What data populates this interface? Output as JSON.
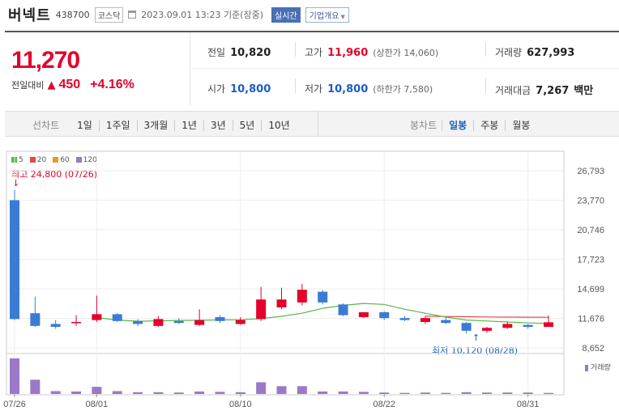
{
  "header": {
    "stock_name": "버넥트",
    "stock_code": "438700",
    "market": "코스닥",
    "datetime": "2023.09.01 13:23 기준(장중)",
    "realtime_label": "실시간",
    "company_info_label": "기업개요"
  },
  "price": {
    "current": "11,270",
    "change_label": "전일대비",
    "change_direction": "up",
    "change_value": "450",
    "change_percent": "+4.16%"
  },
  "stats": {
    "prev_close": {
      "label": "전일",
      "value": "10,820"
    },
    "open": {
      "label": "시가",
      "value": "10,800"
    },
    "high": {
      "label": "고가",
      "value": "11,960",
      "limit_label": "(상한가 14,060)"
    },
    "low": {
      "label": "저가",
      "value": "10,800",
      "limit_label": "(하한가 7,580)"
    },
    "volume": {
      "label": "거래량",
      "value": "627,993"
    },
    "trade_amount": {
      "label": "거래대금",
      "value": "7,267",
      "unit": "백만"
    }
  },
  "period_bar": {
    "line_chart_label": "선차트",
    "line_periods": [
      "1일",
      "1주일",
      "3개월",
      "1년",
      "3년",
      "5년",
      "10년"
    ],
    "candle_chart_label": "봉차트",
    "candle_periods": [
      "일봉",
      "주봉",
      "월봉"
    ],
    "active_candle_period": "일봉"
  },
  "colors": {
    "up": "#e4002b",
    "down": "#1a5fc0",
    "ma5": "#56b848",
    "ma20": "#e24a4a",
    "ma60": "#f0932b",
    "ma120": "#9b79c6"
  },
  "chart_data": {
    "type": "candlestick",
    "legend": [
      {
        "name": "5",
        "color": "#56b848"
      },
      {
        "name": "20",
        "color": "#e24a4a"
      },
      {
        "name": "60",
        "color": "#f0932b"
      },
      {
        "name": "120",
        "color": "#9b79c6"
      }
    ],
    "y_ticks": [
      "26,793",
      "23,770",
      "20,746",
      "17,723",
      "14,699",
      "11,676",
      "8,652"
    ],
    "ylim": [
      8652,
      26793
    ],
    "x_ticks": [
      {
        "label": "07/26",
        "date": "2023-07-26"
      },
      {
        "label": "08/01",
        "date": "2023-08-01"
      },
      {
        "label": "08/10",
        "date": "2023-08-10"
      },
      {
        "label": "08/22",
        "date": "2023-08-22"
      },
      {
        "label": "08/31",
        "date": "2023-08-31"
      }
    ],
    "high_annotation": "최고 24,800 (07/26)",
    "low_annotation": "최저 10,120 (08/28)",
    "volume_label": "거래량",
    "candles": [
      {
        "date": "2023-07-26",
        "o": 23770,
        "h": 24800,
        "l": 11500,
        "c": 11600,
        "v": 1.0
      },
      {
        "date": "2023-07-27",
        "o": 12200,
        "h": 13900,
        "l": 10800,
        "c": 10900,
        "v": 0.4
      },
      {
        "date": "2023-07-28",
        "o": 11100,
        "h": 11500,
        "l": 10600,
        "c": 10800,
        "v": 0.08
      },
      {
        "date": "2023-07-31",
        "o": 11200,
        "h": 12000,
        "l": 10900,
        "c": 11300,
        "v": 0.07
      },
      {
        "date": "2023-08-01",
        "o": 11500,
        "h": 14000,
        "l": 11300,
        "c": 12100,
        "v": 0.2
      },
      {
        "date": "2023-08-02",
        "o": 12100,
        "h": 12200,
        "l": 11300,
        "c": 11400,
        "v": 0.08
      },
      {
        "date": "2023-08-03",
        "o": 11400,
        "h": 11600,
        "l": 10900,
        "c": 11100,
        "v": 0.05
      },
      {
        "date": "2023-08-04",
        "o": 10900,
        "h": 11900,
        "l": 10800,
        "c": 11600,
        "v": 0.05
      },
      {
        "date": "2023-08-07",
        "o": 11400,
        "h": 11700,
        "l": 11100,
        "c": 11200,
        "v": 0.04
      },
      {
        "date": "2023-08-08",
        "o": 11000,
        "h": 12600,
        "l": 10900,
        "c": 11500,
        "v": 0.07
      },
      {
        "date": "2023-08-09",
        "o": 11800,
        "h": 12000,
        "l": 11200,
        "c": 11400,
        "v": 0.06
      },
      {
        "date": "2023-08-10",
        "o": 11100,
        "h": 11800,
        "l": 11000,
        "c": 11500,
        "v": 0.05
      },
      {
        "date": "2023-08-11",
        "o": 11600,
        "h": 14900,
        "l": 11400,
        "c": 13600,
        "v": 0.33
      },
      {
        "date": "2023-08-14",
        "o": 12800,
        "h": 14800,
        "l": 12600,
        "c": 13600,
        "v": 0.22
      },
      {
        "date": "2023-08-16",
        "o": 13300,
        "h": 15200,
        "l": 13000,
        "c": 14600,
        "v": 0.22
      },
      {
        "date": "2023-08-17",
        "o": 14400,
        "h": 14600,
        "l": 13100,
        "c": 13300,
        "v": 0.07
      },
      {
        "date": "2023-08-18",
        "o": 13100,
        "h": 13200,
        "l": 11900,
        "c": 12000,
        "v": 0.07
      },
      {
        "date": "2023-08-21",
        "o": 11800,
        "h": 12300,
        "l": 11700,
        "c": 12300,
        "v": 0.06
      },
      {
        "date": "2023-08-22",
        "o": 12300,
        "h": 12400,
        "l": 11500,
        "c": 11700,
        "v": 0.04
      },
      {
        "date": "2023-08-23",
        "o": 11700,
        "h": 11900,
        "l": 11400,
        "c": 11500,
        "v": 0.03
      },
      {
        "date": "2023-08-24",
        "o": 11300,
        "h": 11900,
        "l": 11100,
        "c": 11700,
        "v": 0.04
      },
      {
        "date": "2023-08-25",
        "o": 11500,
        "h": 11800,
        "l": 11100,
        "c": 11200,
        "v": 0.03
      },
      {
        "date": "2023-08-28",
        "o": 11200,
        "h": 11300,
        "l": 10120,
        "c": 10400,
        "v": 0.05
      },
      {
        "date": "2023-08-29",
        "o": 10400,
        "h": 10800,
        "l": 10200,
        "c": 10700,
        "v": 0.04
      },
      {
        "date": "2023-08-30",
        "o": 10700,
        "h": 11300,
        "l": 10600,
        "c": 11100,
        "v": 0.04
      },
      {
        "date": "2023-08-31",
        "o": 11000,
        "h": 11100,
        "l": 10600,
        "c": 10800,
        "v": 0.04
      },
      {
        "date": "2023-09-01",
        "o": 10800,
        "h": 11960,
        "l": 10800,
        "c": 11270,
        "v": 0.03
      }
    ],
    "ma5": [
      null,
      null,
      null,
      null,
      11750,
      11500,
      11380,
      11420,
      11460,
      11480,
      11520,
      11520,
      11650,
      11880,
      12200,
      12700,
      13000,
      13200,
      13100,
      12600,
      12200,
      11800,
      11500,
      11400,
      11300,
      11200,
      11150
    ],
    "ma20": [
      null,
      null,
      null,
      null,
      null,
      null,
      null,
      null,
      null,
      null,
      null,
      null,
      null,
      null,
      null,
      null,
      null,
      null,
      null,
      null,
      11900,
      11860,
      11840,
      11820,
      11800,
      11790,
      11780
    ]
  }
}
